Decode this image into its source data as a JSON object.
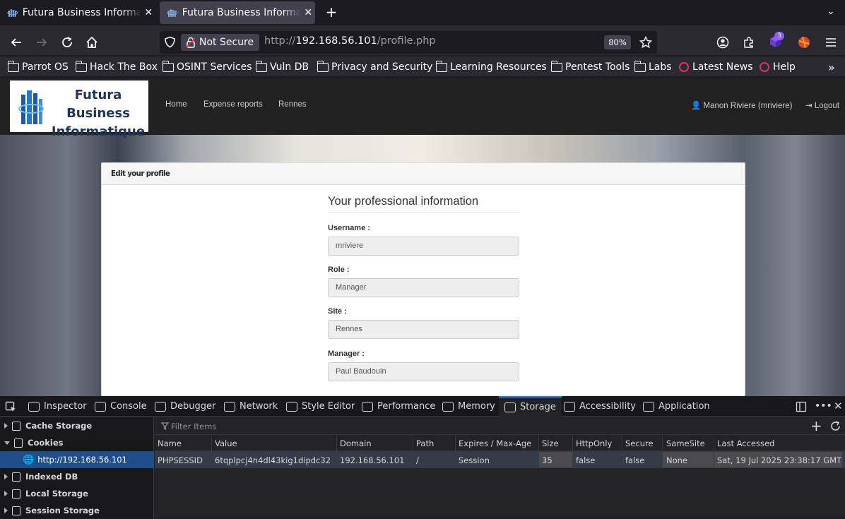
{
  "browser": {
    "tabs": [
      {
        "title": "Futura Business Informatique",
        "active": false
      },
      {
        "title": "Futura Business Informatique",
        "active": true
      }
    ],
    "new_tab_label": "+",
    "security_label": "Not Secure",
    "url_scheme": "http://",
    "url_host": "192.168.56.101",
    "url_path": "/profile.php",
    "zoom": "80%",
    "extension_badge": "3",
    "bookmarks": [
      "Parrot OS",
      "Hack The Box",
      "OSINT Services",
      "Vuln DB",
      "Privacy and Security",
      "Learning Resources",
      "Pentest Tools",
      "Labs",
      "Latest News",
      "Help"
    ],
    "bookmarks_overflow": "»"
  },
  "site": {
    "logo_line1": "Futura Business",
    "logo_line2": "Informatique",
    "nav": [
      "Home",
      "Expense reports",
      "Rennes"
    ],
    "user": "Manon Riviere (mriviere)",
    "logout": "Logout"
  },
  "profile": {
    "panel_title": "Edit your profile",
    "section_title": "Your professional information",
    "fields": [
      {
        "label": "Username :",
        "value": "mriviere"
      },
      {
        "label": "Role :",
        "value": "Manager"
      },
      {
        "label": "Site :",
        "value": "Rennes"
      },
      {
        "label": "Manager :",
        "value": "Paul Baudouin"
      }
    ]
  },
  "devtools": {
    "tabs": [
      "Inspector",
      "Console",
      "Debugger",
      "Network",
      "Style Editor",
      "Performance",
      "Memory",
      "Storage",
      "Accessibility",
      "Application"
    ],
    "active_tab": "Storage",
    "sidebar": [
      "Cache Storage",
      "Cookies",
      "http://192.168.56.101",
      "Indexed DB",
      "Local Storage",
      "Session Storage"
    ],
    "filter_placeholder": "Filter Items",
    "columns": [
      "Name",
      "Value",
      "Domain",
      "Path",
      "Expires / Max-Age",
      "Size",
      "HttpOnly",
      "Secure",
      "SameSite",
      "Last Accessed"
    ],
    "cookie": {
      "name": "PHPSESSID",
      "value": "6tqplpcj4n4dl43kig1dipdc32",
      "domain": "192.168.56.101",
      "path": "/",
      "expires": "Session",
      "size": "35",
      "httponly": "false",
      "secure": "false",
      "samesite": "None",
      "last_accessed": "Sat, 19 Jul 2025 23:38:17 GMT"
    }
  }
}
